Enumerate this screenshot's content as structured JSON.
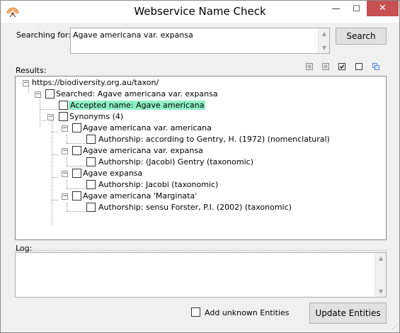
{
  "window": {
    "title": "Webservice Name Check",
    "minimize_glyph": "—",
    "maximize_glyph": "☐",
    "close_glyph": "✕"
  },
  "search": {
    "label": "Searching for:",
    "value": "Agave americana var. expansa",
    "button_label": "Search"
  },
  "results": {
    "label": "Results:",
    "toolbar_icons": [
      "collapse-all-icon",
      "expand-all-icon",
      "check-all-icon",
      "uncheck-all-icon",
      "copy-icon"
    ],
    "tree": [
      {
        "text": "https://biodiversity.org.au/taxon/"
      },
      {
        "text": "Searched: Agave americana var. expansa"
      },
      {
        "text": "Accepted name: Agave americana",
        "highlight_color": "#8ff0c8"
      },
      {
        "text": "Synonyms (4)"
      },
      {
        "text": "Agave americana var. americana"
      },
      {
        "text": "Authorship: according to Gentry, H. (1972) (nomenclatural)"
      },
      {
        "text": "Agave americana var. expansa"
      },
      {
        "text": "Authorship: (Jacobi) Gentry (taxonomic)"
      },
      {
        "text": "Agave expansa"
      },
      {
        "text": "Authorship: Jacobi (taxonomic)"
      },
      {
        "text": "Agave americana 'Marginata'"
      },
      {
        "text": "Authorship: sensu Forster, P.I. (2002) (taxonomic)"
      }
    ]
  },
  "log": {
    "label": "Log:",
    "value": ""
  },
  "footer": {
    "add_unknown_label": "Add unknown Entities",
    "add_unknown_checked": false,
    "update_button_label": "Update Entities"
  },
  "colors": {
    "close_button": "#c75050",
    "highlight": "#8ff0c8"
  }
}
